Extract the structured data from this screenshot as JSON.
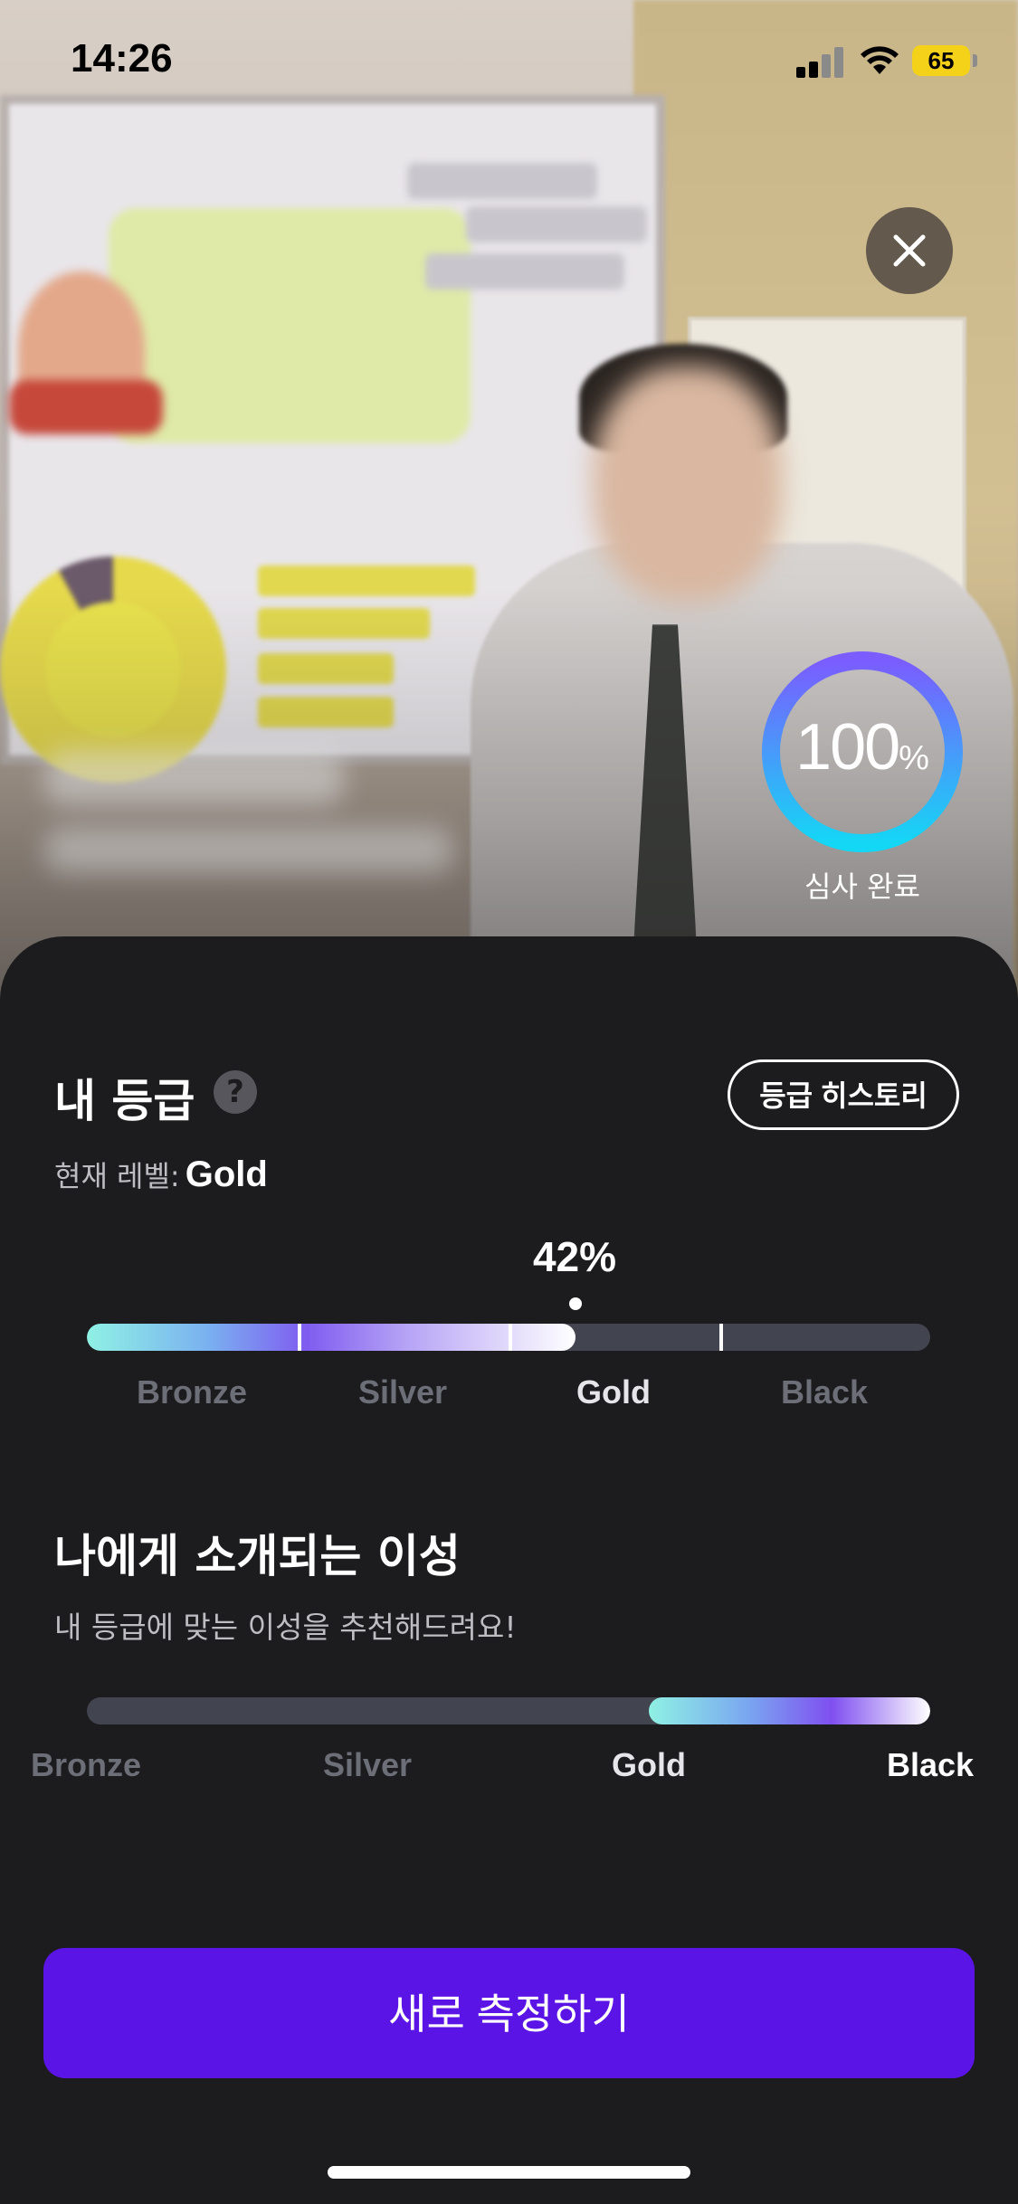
{
  "status_bar": {
    "time": "14:26",
    "battery": "65"
  },
  "review": {
    "value": "100",
    "percent_sign": "%",
    "progress": 1.0,
    "label": "심사 완료"
  },
  "grade": {
    "title": "내 등급",
    "history_button": "등급 히스토리",
    "current_level_label": "현재 레벨:",
    "current_level_value": "Gold",
    "progress_percent": "42%",
    "progress_fraction": 0.42,
    "tiers": [
      "Bronze",
      "Silver",
      "Gold",
      "Black"
    ]
  },
  "intro": {
    "title": "나에게 소개되는 이성",
    "subtitle": "내 등급에 맞는 이성을 추천해드려요!",
    "tiers": [
      "Bronze",
      "Silver",
      "Gold",
      "Black"
    ]
  },
  "cta": {
    "label": "새로 측정하기"
  },
  "icons": [
    "close-icon",
    "help-icon",
    "signal-icon",
    "wifi-icon",
    "battery-icon"
  ],
  "colors": {
    "accent": "#5b14e6",
    "track": "#42444f",
    "ring_start": "#7b5cff",
    "ring_end": "#14d7f5"
  }
}
